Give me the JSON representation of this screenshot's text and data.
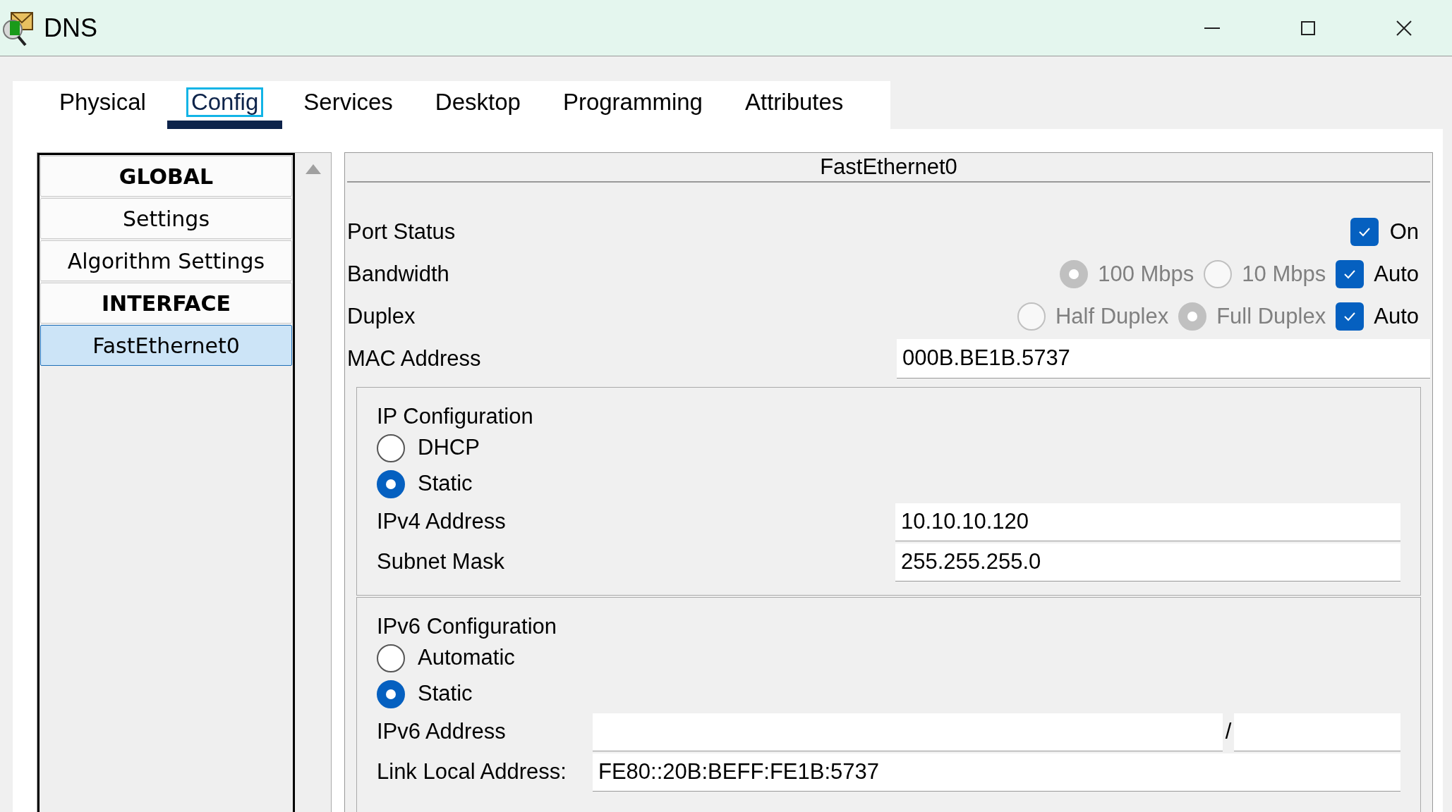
{
  "window": {
    "title": "DNS"
  },
  "tabs": [
    {
      "label": "Physical",
      "selected": false
    },
    {
      "label": "Config",
      "selected": true
    },
    {
      "label": "Services",
      "selected": false
    },
    {
      "label": "Desktop",
      "selected": false
    },
    {
      "label": "Programming",
      "selected": false
    },
    {
      "label": "Attributes",
      "selected": false
    }
  ],
  "sidebar": {
    "items": [
      {
        "label": "GLOBAL",
        "kind": "header",
        "selected": false
      },
      {
        "label": "Settings",
        "kind": "item",
        "selected": false
      },
      {
        "label": "Algorithm Settings",
        "kind": "item",
        "selected": false
      },
      {
        "label": "INTERFACE",
        "kind": "header",
        "selected": false
      },
      {
        "label": "FastEthernet0",
        "kind": "item",
        "selected": true
      }
    ]
  },
  "panel": {
    "title": "FastEthernet0",
    "port_status": {
      "label": "Port Status",
      "option": "On",
      "checked": true
    },
    "bandwidth": {
      "label": "Bandwidth",
      "options": [
        {
          "label": "100 Mbps",
          "selected": true,
          "disabled": true
        },
        {
          "label": "10 Mbps",
          "selected": false,
          "disabled": true
        }
      ],
      "auto": {
        "label": "Auto",
        "checked": true
      }
    },
    "duplex": {
      "label": "Duplex",
      "options": [
        {
          "label": "Half Duplex",
          "selected": false,
          "disabled": true
        },
        {
          "label": "Full Duplex",
          "selected": true,
          "disabled": true
        }
      ],
      "auto": {
        "label": "Auto",
        "checked": true
      }
    },
    "mac": {
      "label": "MAC Address",
      "value": "000B.BE1B.5737"
    },
    "ipv4": {
      "title": "IP Configuration",
      "modes": [
        {
          "label": "DHCP",
          "selected": false
        },
        {
          "label": "Static",
          "selected": true
        }
      ],
      "fields": [
        {
          "label": "IPv4 Address",
          "value": "10.10.10.120"
        },
        {
          "label": "Subnet Mask",
          "value": "255.255.255.0"
        }
      ]
    },
    "ipv6": {
      "title": "IPv6 Configuration",
      "modes": [
        {
          "label": "Automatic",
          "selected": false
        },
        {
          "label": "Static",
          "selected": true
        }
      ],
      "address": {
        "label": "IPv6 Address",
        "separator": "/"
      },
      "link_local": {
        "label": "Link Local Address:",
        "value": "FE80::20B:BEFF:FE1B:5737"
      }
    }
  }
}
